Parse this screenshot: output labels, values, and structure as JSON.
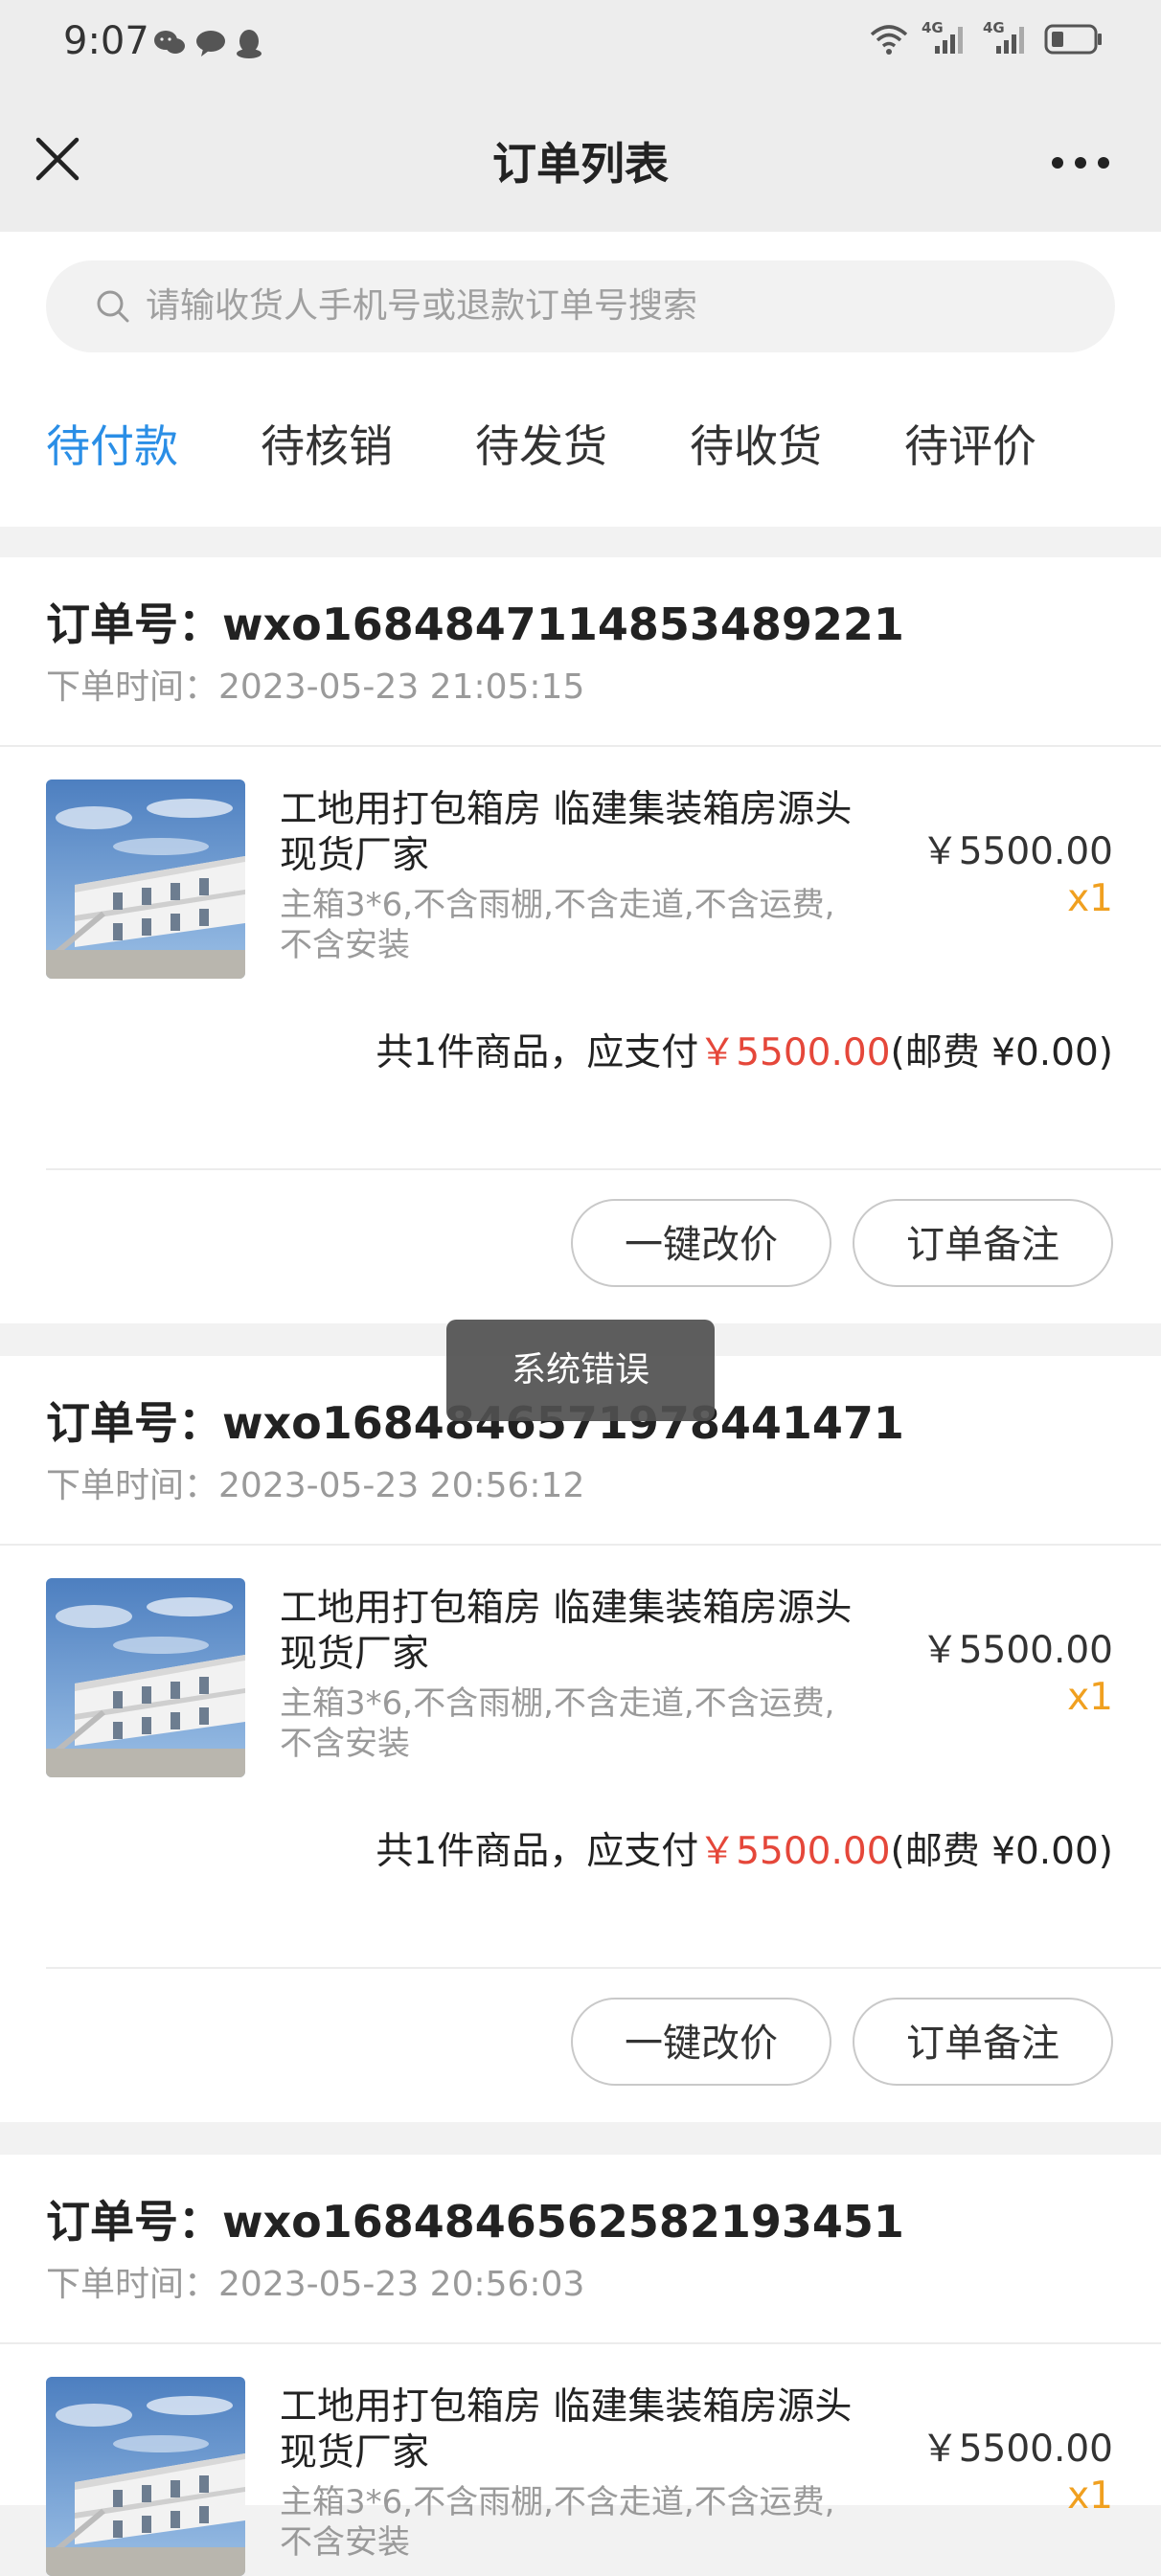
{
  "status_bar": {
    "time": "9:07",
    "net1": "4G",
    "net2": "4G"
  },
  "header": {
    "title": "订单列表"
  },
  "search": {
    "placeholder": "请输收货人手机号或退款订单号搜索"
  },
  "tabs": [
    {
      "label": "待付款",
      "active": true
    },
    {
      "label": "待核销",
      "active": false
    },
    {
      "label": "待发货",
      "active": false
    },
    {
      "label": "待收货",
      "active": false
    },
    {
      "label": "待评价",
      "active": false
    }
  ],
  "order_no_label": "订单号：",
  "order_time_label": "下单时间：",
  "orders": [
    {
      "order_no": "wxo1684847114853489221",
      "time": "2023-05-23 21:05:15",
      "product_name": "工地用打包箱房 临建集装箱房源头现货厂家",
      "spec": "主箱3*6,不含雨棚,不含走道,不含运费,不含安装",
      "price": "￥5500.00",
      "qty": "x1",
      "summary_prefix": "共1件商品，应支付",
      "summary_amount": "￥5500.00",
      "summary_shipping": "(邮费 ¥0.00)",
      "btn_change_price": "一键改价",
      "btn_note": "订单备注"
    },
    {
      "order_no": "wxo1684846571978441471",
      "time": "2023-05-23 20:56:12",
      "product_name": "工地用打包箱房 临建集装箱房源头现货厂家",
      "spec": "主箱3*6,不含雨棚,不含走道,不含运费,不含安装",
      "price": "￥5500.00",
      "qty": "x1",
      "summary_prefix": "共1件商品，应支付",
      "summary_amount": "￥5500.00",
      "summary_shipping": "(邮费 ¥0.00)",
      "btn_change_price": "一键改价",
      "btn_note": "订单备注"
    },
    {
      "order_no": "wxo1684846562582193451",
      "time": "2023-05-23 20:56:03",
      "product_name": "工地用打包箱房 临建集装箱房源头现货厂家",
      "spec": "主箱3*6,不含雨棚,不含走道,不含运费,不含安装",
      "price": "￥5500.00",
      "qty": "x1"
    }
  ],
  "toast": {
    "text": "系统错误"
  },
  "colors": {
    "accent": "#2a8ee6",
    "price_red": "#e5473a",
    "qty_orange": "#f0a020"
  },
  "icons": [
    "wechat-icon",
    "chat-bubble-icon",
    "qq-penguin-icon",
    "wifi-icon",
    "signal-icon",
    "battery-icon",
    "close-icon",
    "more-icon",
    "search-icon"
  ]
}
